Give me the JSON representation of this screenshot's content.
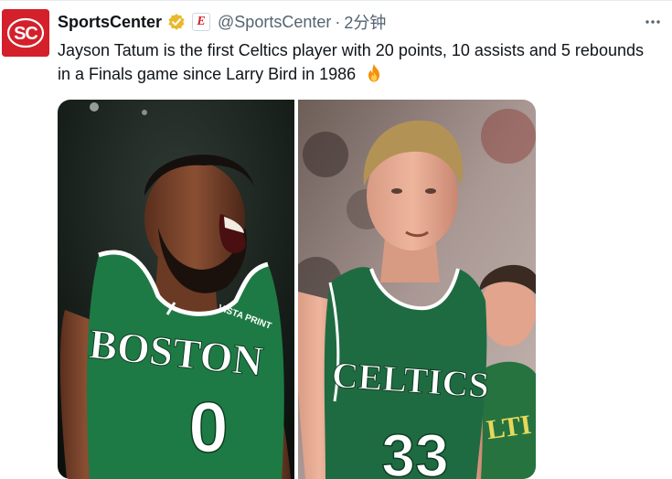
{
  "tweet": {
    "display_name": "SportsCenter",
    "handle": "@SportsCenter",
    "separator": "·",
    "timestamp": "2分钟",
    "affiliate_badge_letter": "E",
    "text": "Jayson Tatum is the first Celtics player with 20 points, 10 assists and 5 rebounds in a Finals game since Larry Bird in 1986",
    "emoji_icon": "fire-icon",
    "more_icon": "more-horizontal-icon",
    "more_label": "···",
    "verified_color": "#e8b82d",
    "brand_color": "#d3202b"
  },
  "media": {
    "left_photo": {
      "jersey_text": "BOSTON",
      "jersey_number": "0",
      "patch_text": "VISTA PRINT",
      "jersey_color": "#1e7a44"
    },
    "right_photo": {
      "jersey_text": "CELTICS",
      "jersey_number": "33",
      "partial_jersey_text": "LTI",
      "jersey_color": "#1f6b41"
    }
  }
}
